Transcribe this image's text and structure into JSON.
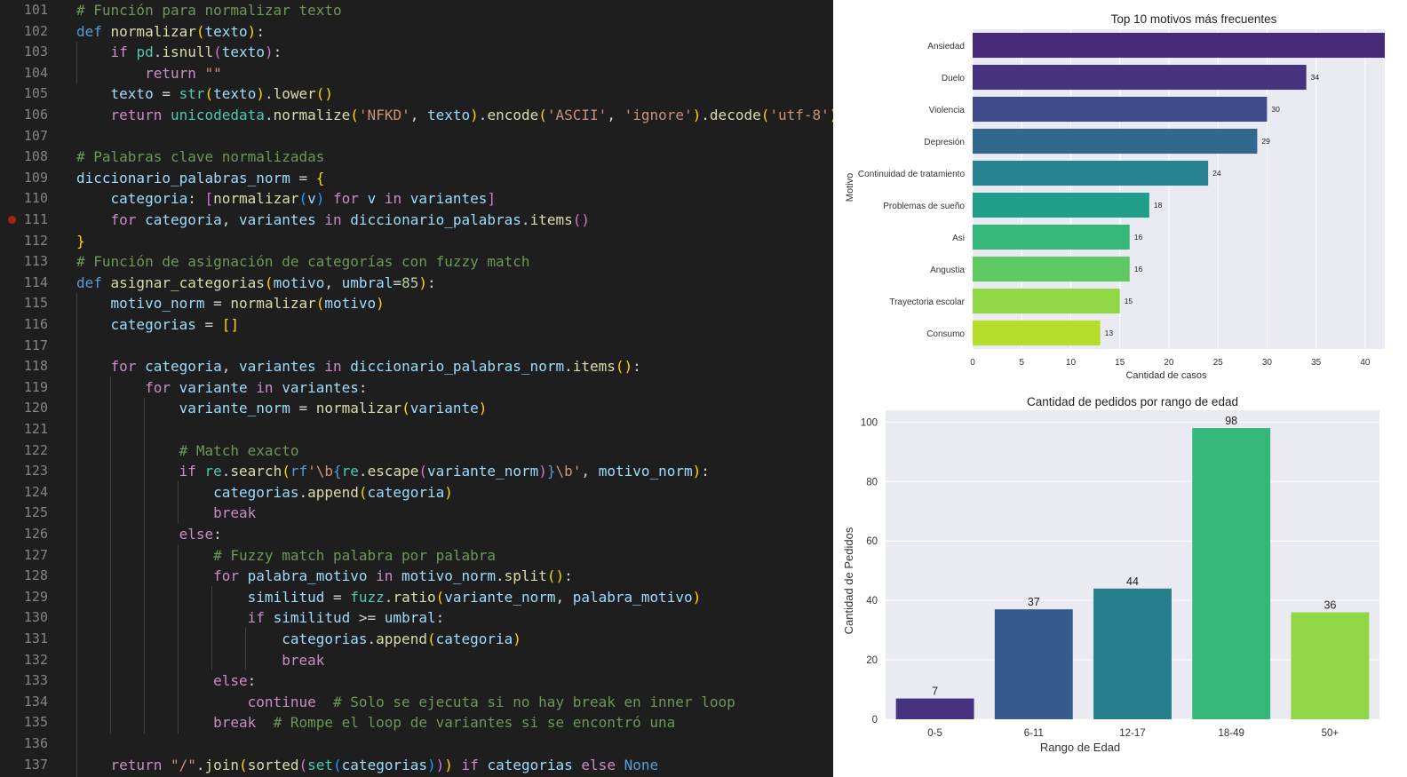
{
  "editor": {
    "start_line": 101,
    "breakpoint_line": 111,
    "lines": [
      [
        [
          "g",
          "# Función para normalizar texto"
        ]
      ],
      [
        [
          "k",
          "def "
        ],
        [
          "f",
          "normalizar"
        ],
        [
          "p",
          "("
        ],
        [
          "v",
          "texto"
        ],
        [
          "p",
          ")"
        ],
        [
          "o",
          ":"
        ]
      ],
      [
        [
          "o",
          "    "
        ],
        [
          "c",
          "if "
        ],
        [
          "t",
          "pd"
        ],
        [
          "o",
          "."
        ],
        [
          "f",
          "isnull"
        ],
        [
          "q",
          "("
        ],
        [
          "v",
          "texto"
        ],
        [
          "q",
          ")"
        ],
        [
          "o",
          ":"
        ]
      ],
      [
        [
          "o",
          "        "
        ],
        [
          "c",
          "return "
        ],
        [
          "s",
          "\"\""
        ]
      ],
      [
        [
          "o",
          "    "
        ],
        [
          "v",
          "texto"
        ],
        [
          "o",
          " = "
        ],
        [
          "t",
          "str"
        ],
        [
          "p",
          "("
        ],
        [
          "v",
          "texto"
        ],
        [
          "p",
          ")"
        ],
        [
          "o",
          "."
        ],
        [
          "f",
          "lower"
        ],
        [
          "p",
          "()"
        ]
      ],
      [
        [
          "o",
          "    "
        ],
        [
          "c",
          "return "
        ],
        [
          "t",
          "unicodedata"
        ],
        [
          "o",
          "."
        ],
        [
          "f",
          "normalize"
        ],
        [
          "p",
          "("
        ],
        [
          "s",
          "'NFKD'"
        ],
        [
          "o",
          ", "
        ],
        [
          "v",
          "texto"
        ],
        [
          "p",
          ")"
        ],
        [
          "o",
          "."
        ],
        [
          "f",
          "encode"
        ],
        [
          "p",
          "("
        ],
        [
          "s",
          "'ASCII'"
        ],
        [
          "o",
          ", "
        ],
        [
          "s",
          "'ignore'"
        ],
        [
          "p",
          ")"
        ],
        [
          "o",
          "."
        ],
        [
          "f",
          "decode"
        ],
        [
          "p",
          "("
        ],
        [
          "s",
          "'utf-8'"
        ],
        [
          "p",
          ")"
        ]
      ],
      [],
      [
        [
          "g",
          "# Palabras clave normalizadas"
        ]
      ],
      [
        [
          "v",
          "diccionario_palabras_norm"
        ],
        [
          "o",
          " = "
        ],
        [
          "p",
          "{"
        ]
      ],
      [
        [
          "o",
          "    "
        ],
        [
          "v",
          "categoria"
        ],
        [
          "o",
          ": "
        ],
        [
          "q",
          "["
        ],
        [
          "f",
          "normalizar"
        ],
        [
          "r",
          "("
        ],
        [
          "v",
          "v"
        ],
        [
          "r",
          ")"
        ],
        [
          "c",
          " for "
        ],
        [
          "v",
          "v"
        ],
        [
          "c",
          " in "
        ],
        [
          "v",
          "variantes"
        ],
        [
          "q",
          "]"
        ]
      ],
      [
        [
          "o",
          "    "
        ],
        [
          "c",
          "for "
        ],
        [
          "v",
          "categoria"
        ],
        [
          "o",
          ", "
        ],
        [
          "v",
          "variantes"
        ],
        [
          "c",
          " in "
        ],
        [
          "v",
          "diccionario_palabras"
        ],
        [
          "o",
          "."
        ],
        [
          "f",
          "items"
        ],
        [
          "q",
          "()"
        ]
      ],
      [
        [
          "p",
          "}"
        ]
      ],
      [
        [
          "g",
          "# Función de asignación de categorías con fuzzy match"
        ]
      ],
      [
        [
          "k",
          "def "
        ],
        [
          "f",
          "asignar_categorias"
        ],
        [
          "p",
          "("
        ],
        [
          "v",
          "motivo"
        ],
        [
          "o",
          ", "
        ],
        [
          "v",
          "umbral"
        ],
        [
          "o",
          "="
        ],
        [
          "n",
          "85"
        ],
        [
          "p",
          ")"
        ],
        [
          "o",
          ":"
        ]
      ],
      [
        [
          "o",
          "    "
        ],
        [
          "v",
          "motivo_norm"
        ],
        [
          "o",
          " = "
        ],
        [
          "f",
          "normalizar"
        ],
        [
          "p",
          "("
        ],
        [
          "v",
          "motivo"
        ],
        [
          "p",
          ")"
        ]
      ],
      [
        [
          "o",
          "    "
        ],
        [
          "v",
          "categorias"
        ],
        [
          "o",
          " = "
        ],
        [
          "p",
          "[]"
        ]
      ],
      [],
      [
        [
          "o",
          "    "
        ],
        [
          "c",
          "for "
        ],
        [
          "v",
          "categoria"
        ],
        [
          "o",
          ", "
        ],
        [
          "v",
          "variantes"
        ],
        [
          "c",
          " in "
        ],
        [
          "v",
          "diccionario_palabras_norm"
        ],
        [
          "o",
          "."
        ],
        [
          "f",
          "items"
        ],
        [
          "p",
          "()"
        ],
        [
          "o",
          ":"
        ]
      ],
      [
        [
          "o",
          "        "
        ],
        [
          "c",
          "for "
        ],
        [
          "v",
          "variante"
        ],
        [
          "c",
          " in "
        ],
        [
          "v",
          "variantes"
        ],
        [
          "o",
          ":"
        ]
      ],
      [
        [
          "o",
          "            "
        ],
        [
          "v",
          "variante_norm"
        ],
        [
          "o",
          " = "
        ],
        [
          "f",
          "normalizar"
        ],
        [
          "p",
          "("
        ],
        [
          "v",
          "variante"
        ],
        [
          "p",
          ")"
        ]
      ],
      [],
      [
        [
          "o",
          "            "
        ],
        [
          "g",
          "# Match exacto"
        ]
      ],
      [
        [
          "o",
          "            "
        ],
        [
          "c",
          "if "
        ],
        [
          "t",
          "re"
        ],
        [
          "o",
          "."
        ],
        [
          "f",
          "search"
        ],
        [
          "p",
          "("
        ],
        [
          "k",
          "rf"
        ],
        [
          "s",
          "'\\b"
        ],
        [
          "k",
          "{"
        ],
        [
          "t",
          "re"
        ],
        [
          "o",
          "."
        ],
        [
          "f",
          "escape"
        ],
        [
          "q",
          "("
        ],
        [
          "v",
          "variante_norm"
        ],
        [
          "q",
          ")"
        ],
        [
          "k",
          "}"
        ],
        [
          "s",
          "\\b'"
        ],
        [
          "o",
          ", "
        ],
        [
          "v",
          "motivo_norm"
        ],
        [
          "p",
          ")"
        ],
        [
          "o",
          ":"
        ]
      ],
      [
        [
          "o",
          "                "
        ],
        [
          "v",
          "categorias"
        ],
        [
          "o",
          "."
        ],
        [
          "f",
          "append"
        ],
        [
          "p",
          "("
        ],
        [
          "v",
          "categoria"
        ],
        [
          "p",
          ")"
        ]
      ],
      [
        [
          "o",
          "                "
        ],
        [
          "c",
          "break"
        ]
      ],
      [
        [
          "o",
          "            "
        ],
        [
          "c",
          "else"
        ],
        [
          "o",
          ":"
        ]
      ],
      [
        [
          "o",
          "                "
        ],
        [
          "g",
          "# Fuzzy match palabra por palabra"
        ]
      ],
      [
        [
          "o",
          "                "
        ],
        [
          "c",
          "for "
        ],
        [
          "v",
          "palabra_motivo"
        ],
        [
          "c",
          " in "
        ],
        [
          "v",
          "motivo_norm"
        ],
        [
          "o",
          "."
        ],
        [
          "f",
          "split"
        ],
        [
          "p",
          "()"
        ],
        [
          "o",
          ":"
        ]
      ],
      [
        [
          "o",
          "                    "
        ],
        [
          "v",
          "similitud"
        ],
        [
          "o",
          " = "
        ],
        [
          "t",
          "fuzz"
        ],
        [
          "o",
          "."
        ],
        [
          "f",
          "ratio"
        ],
        [
          "p",
          "("
        ],
        [
          "v",
          "variante_norm"
        ],
        [
          "o",
          ", "
        ],
        [
          "v",
          "palabra_motivo"
        ],
        [
          "p",
          ")"
        ]
      ],
      [
        [
          "o",
          "                    "
        ],
        [
          "c",
          "if "
        ],
        [
          "v",
          "similitud"
        ],
        [
          "o",
          " >= "
        ],
        [
          "v",
          "umbral"
        ],
        [
          "o",
          ":"
        ]
      ],
      [
        [
          "o",
          "                        "
        ],
        [
          "v",
          "categorias"
        ],
        [
          "o",
          "."
        ],
        [
          "f",
          "append"
        ],
        [
          "p",
          "("
        ],
        [
          "v",
          "categoria"
        ],
        [
          "p",
          ")"
        ]
      ],
      [
        [
          "o",
          "                        "
        ],
        [
          "c",
          "break"
        ]
      ],
      [
        [
          "o",
          "                "
        ],
        [
          "c",
          "else"
        ],
        [
          "o",
          ":"
        ]
      ],
      [
        [
          "o",
          "                    "
        ],
        [
          "c",
          "continue"
        ],
        [
          "o",
          "  "
        ],
        [
          "g",
          "# Solo se ejecuta si no hay break en inner loop"
        ]
      ],
      [
        [
          "o",
          "                "
        ],
        [
          "c",
          "break"
        ],
        [
          "o",
          "  "
        ],
        [
          "g",
          "# Rompe el loop de variantes si se encontró una"
        ]
      ],
      [],
      [
        [
          "o",
          "    "
        ],
        [
          "c",
          "return "
        ],
        [
          "s",
          "\"/\""
        ],
        [
          "o",
          "."
        ],
        [
          "f",
          "join"
        ],
        [
          "p",
          "("
        ],
        [
          "f",
          "sorted"
        ],
        [
          "q",
          "("
        ],
        [
          "t",
          "set"
        ],
        [
          "r",
          "("
        ],
        [
          "v",
          "categorias"
        ],
        [
          "r",
          ")"
        ],
        [
          "q",
          ")"
        ],
        [
          "p",
          ")"
        ],
        [
          "c",
          " if "
        ],
        [
          "v",
          "categorias"
        ],
        [
          "c",
          " else "
        ],
        [
          "k",
          "None"
        ]
      ]
    ]
  },
  "chart_data": [
    {
      "type": "bar",
      "orientation": "horizontal",
      "title": "Top 10 motivos más frecuentes",
      "xlabel": "Cantidad de casos",
      "ylabel": "Motivo",
      "categories": [
        "Ansiedad",
        "Duelo",
        "Violencia",
        "Depresión",
        "Continuidad de tratamiento",
        "Problemas de sueño",
        "Asi",
        "Angustia",
        "Trayectoria escolar",
        "Consumo"
      ],
      "values": [
        42,
        34,
        30,
        29,
        24,
        18,
        16,
        16,
        15,
        13
      ],
      "value_labels": [
        "",
        "34",
        "30",
        "29",
        "24",
        "18",
        "16",
        "16",
        "15",
        "13"
      ],
      "xticks": [
        0,
        5,
        10,
        15,
        20,
        25,
        30,
        35,
        40
      ],
      "xlim": [
        0,
        42
      ],
      "grid": true,
      "colors": [
        "#482878",
        "#46337e",
        "#3e4a89",
        "#31688e",
        "#26828e",
        "#1f9e89",
        "#35b779",
        "#5ec962",
        "#8fd744",
        "#b5de2b"
      ]
    },
    {
      "type": "bar",
      "title": "Cantidad de pedidos por rango de edad",
      "xlabel": "Rango de Edad",
      "ylabel": "Cantidad de Pedidos",
      "categories": [
        "0-5",
        "6-11",
        "12-17",
        "18-49",
        "50+"
      ],
      "values": [
        7,
        37,
        44,
        98,
        36
      ],
      "yticks": [
        0,
        20,
        40,
        60,
        80,
        100
      ],
      "ylim": [
        0,
        104
      ],
      "grid": true,
      "colors": [
        "#46327e",
        "#365c8d",
        "#277f8e",
        "#35b779",
        "#8fd744"
      ]
    }
  ]
}
